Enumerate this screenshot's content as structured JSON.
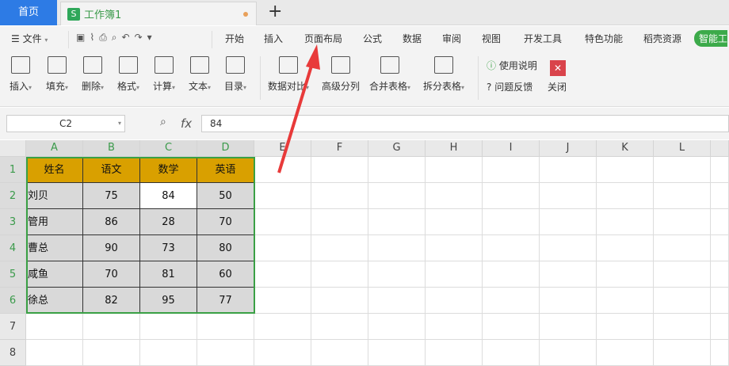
{
  "tabs": {
    "home": "首页",
    "doc": "工作簿1",
    "doc_icon": "S",
    "new_tab": "+"
  },
  "menu": {
    "file": "文件",
    "items": [
      "开始",
      "插入",
      "页面布局",
      "公式",
      "数据",
      "审阅",
      "视图",
      "开发工具",
      "特色功能",
      "稻壳资源"
    ],
    "smart": "智能工"
  },
  "toolbar": {
    "tools": [
      "插入",
      "填充",
      "删除",
      "格式",
      "计算",
      "文本",
      "目录",
      "数据对比",
      "高级分列",
      "合并表格",
      "拆分表格"
    ],
    "help": "使用说明",
    "feedback": "问题反馈",
    "close": "关闭"
  },
  "formula": {
    "cell_ref": "C2",
    "fx": "fx",
    "value": "84"
  },
  "sheet": {
    "columns": [
      "A",
      "B",
      "C",
      "D",
      "E",
      "F",
      "G",
      "H",
      "I",
      "J",
      "K",
      "L"
    ],
    "rows": [
      "1",
      "2",
      "3",
      "4",
      "5",
      "6",
      "7",
      "8"
    ],
    "header": [
      "姓名",
      "语文",
      "数学",
      "英语"
    ],
    "data": [
      [
        "刘贝",
        "75",
        "84",
        "50"
      ],
      [
        "管用",
        "86",
        "28",
        "70"
      ],
      [
        "曹总",
        "90",
        "73",
        "80"
      ],
      [
        "咸鱼",
        "70",
        "81",
        "60"
      ],
      [
        "徐总",
        "82",
        "95",
        "77"
      ]
    ]
  },
  "colors": {
    "accent": "#2d7be5",
    "header_fill": "#d9a000",
    "selection": "#3aa045",
    "arrow": "#e83a3a"
  }
}
